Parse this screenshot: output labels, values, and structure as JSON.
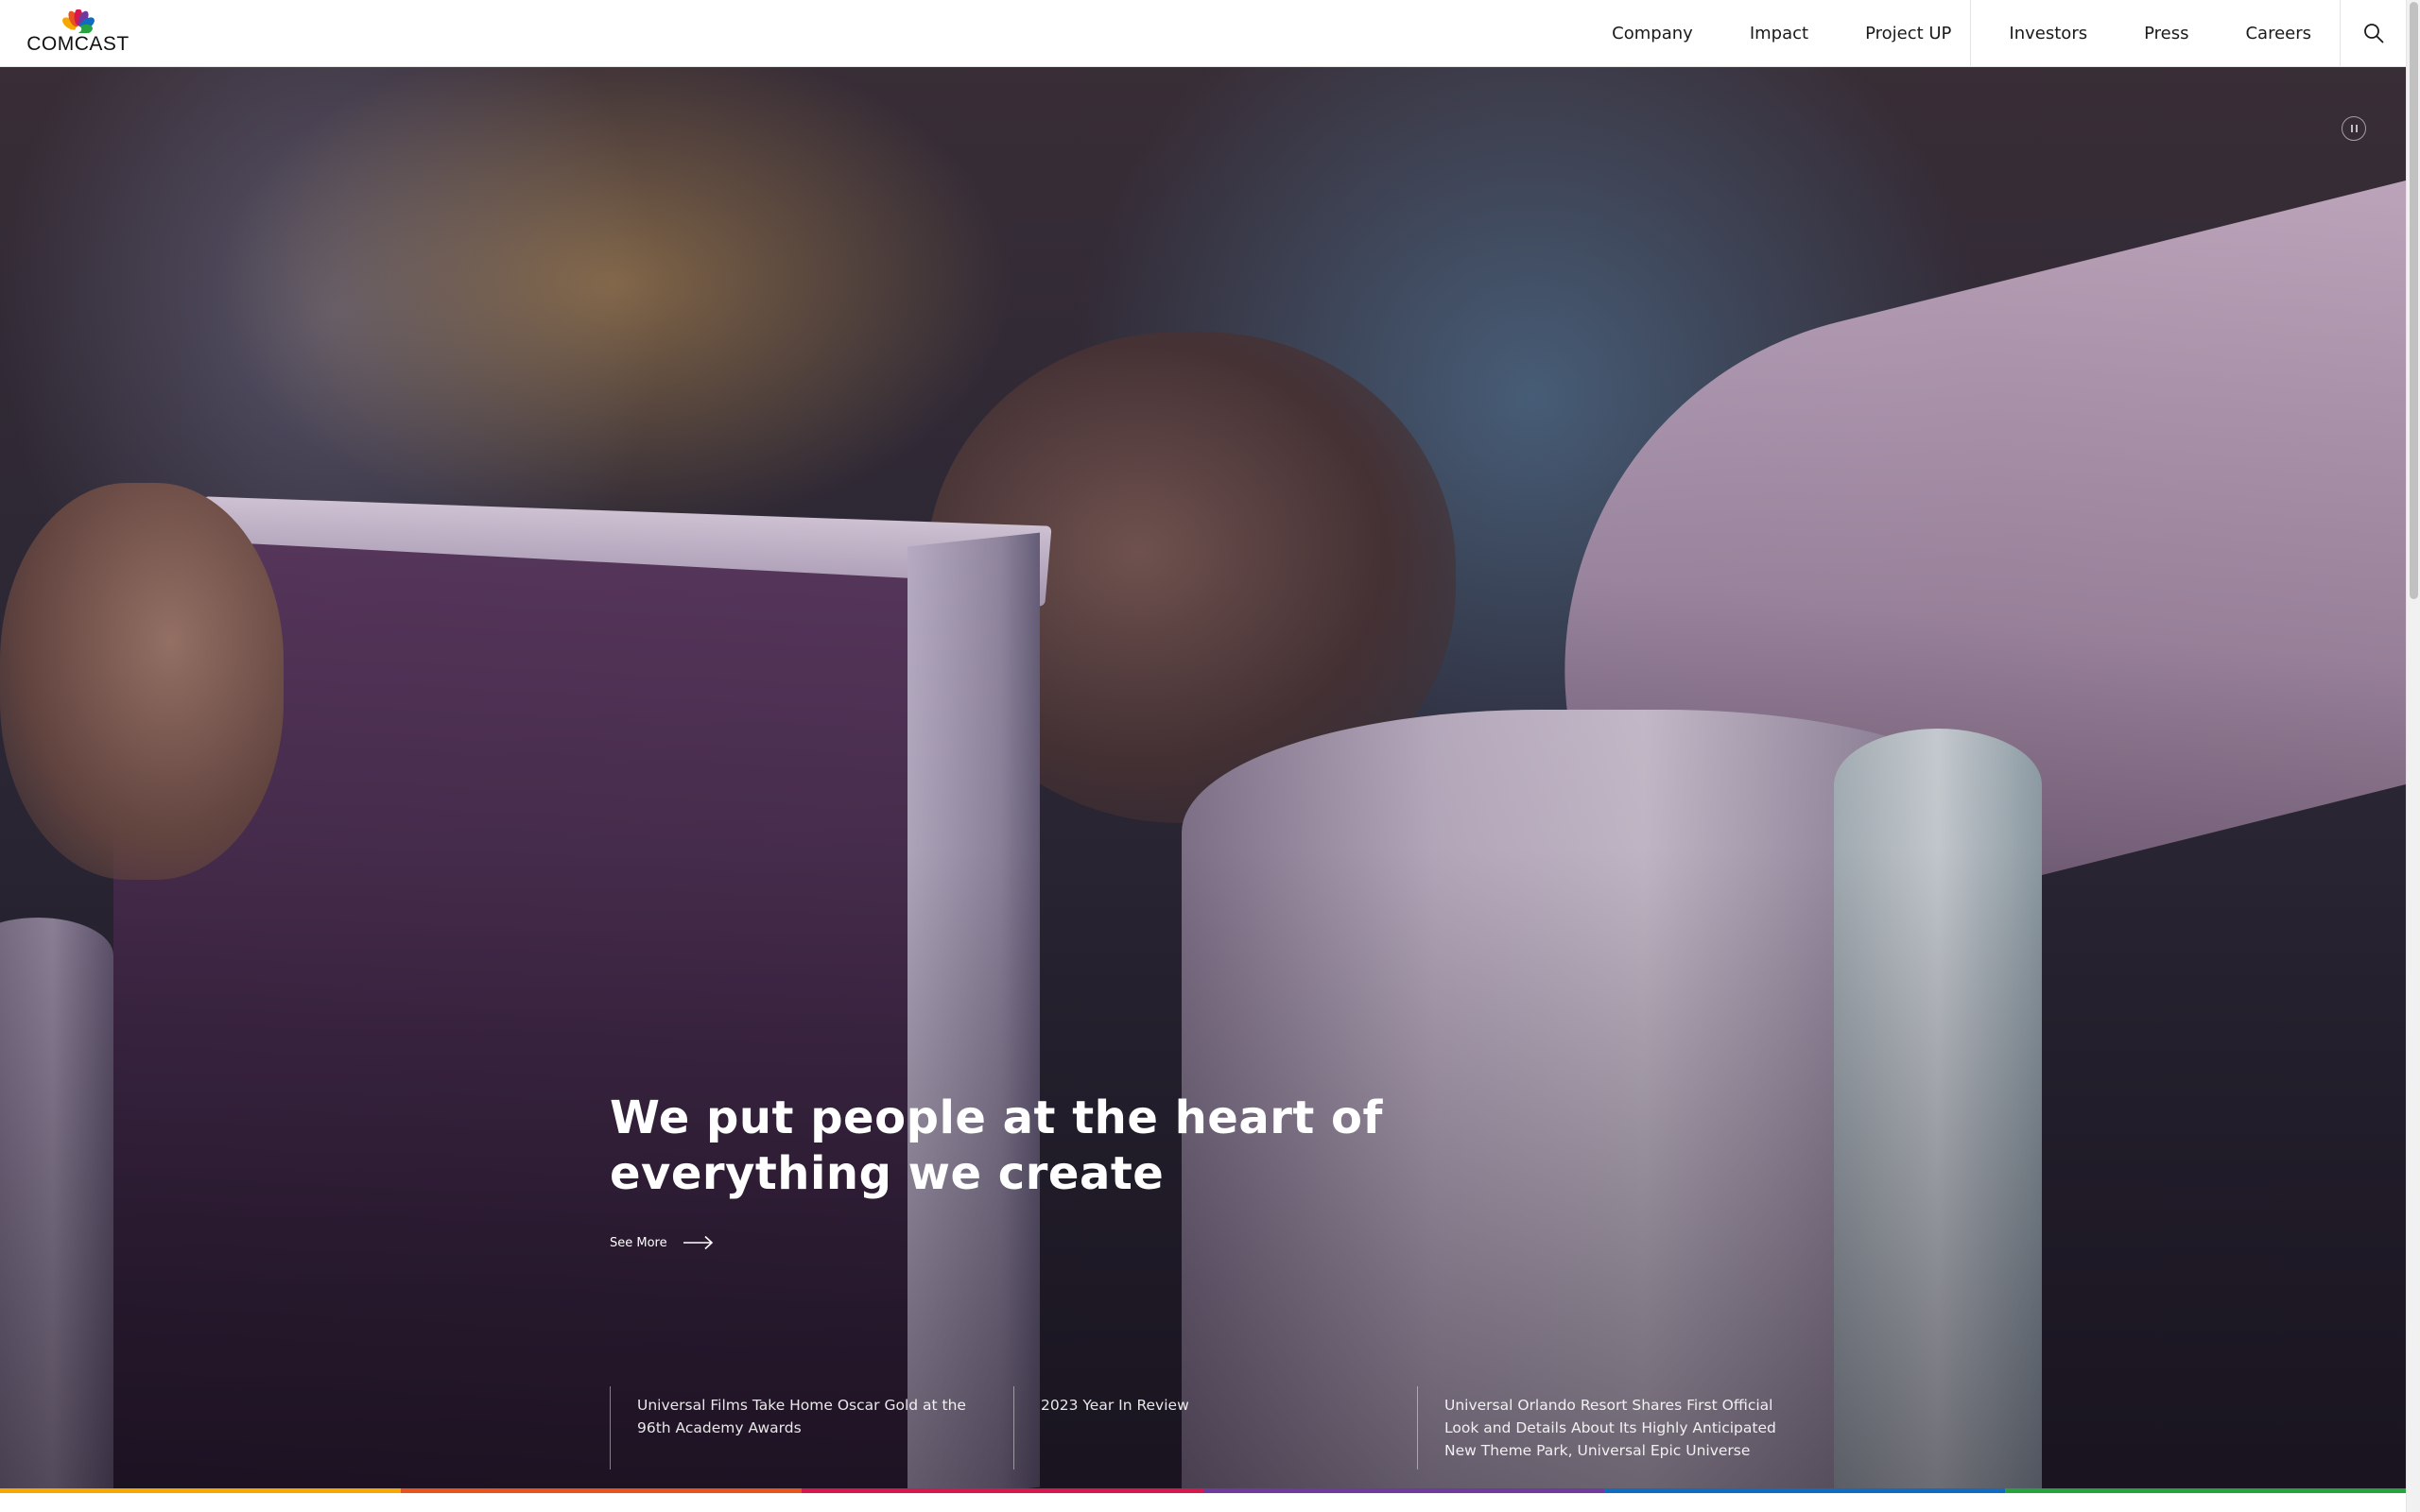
{
  "header": {
    "logo_text": "COMCAST",
    "logo_icon": "peacock-logo-icon",
    "nav": [
      {
        "label": "Company"
      },
      {
        "label": "Impact"
      },
      {
        "label": "Project UP"
      },
      {
        "label": "Investors"
      },
      {
        "label": "Press"
      },
      {
        "label": "Careers"
      }
    ],
    "search_icon": "search-icon"
  },
  "hero": {
    "headline": "We put people at the heart of everything we create",
    "see_more_label": "See More",
    "pause_icon": "pause-icon",
    "news": [
      {
        "title": "Universal Films Take Home Oscar Gold at the 96th Academy Awards"
      },
      {
        "title": "2023 Year In Review"
      },
      {
        "title": "Universal Orlando Resort Shares First Official Look and Details About Its Highly Anticipated New Theme Park, Universal Epic Universe"
      }
    ]
  },
  "colors": {
    "rainbow": [
      "#f6a800",
      "#e8541e",
      "#d7174d",
      "#6e3a9e",
      "#0f6cc1",
      "#26a23e"
    ]
  }
}
